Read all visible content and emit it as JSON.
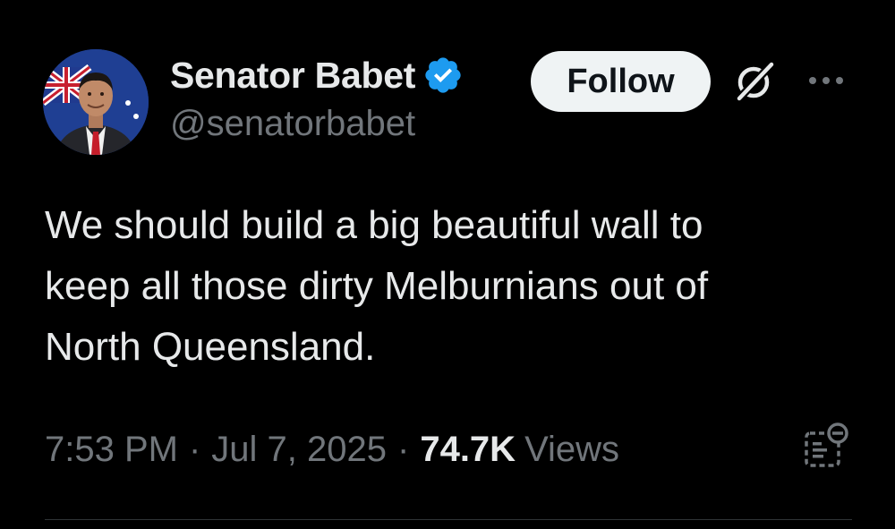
{
  "author": {
    "display_name": "Senator Babet",
    "handle": "@senatorbabet",
    "verified": true,
    "verified_badge_color": "#1d9bf0"
  },
  "actions": {
    "follow_label": "Follow",
    "icons": [
      "grok-icon",
      "more-options-icon",
      "view-analytics-icon"
    ]
  },
  "tweet": {
    "text": "We should build a big beautiful wall to\nkeep all those dirty Melburnians out of\nNorth Queensland."
  },
  "meta": {
    "time": "7:53 PM",
    "date": "Jul 7, 2025",
    "separator": "·",
    "views_count": "74.7K",
    "views_label": "Views"
  },
  "colors": {
    "background": "#000000",
    "primary_text": "#e7e9ea",
    "secondary_text": "#71767b",
    "follow_button_bg": "#eff3f4",
    "follow_button_text": "#0f1419",
    "divider": "#2f3336"
  }
}
